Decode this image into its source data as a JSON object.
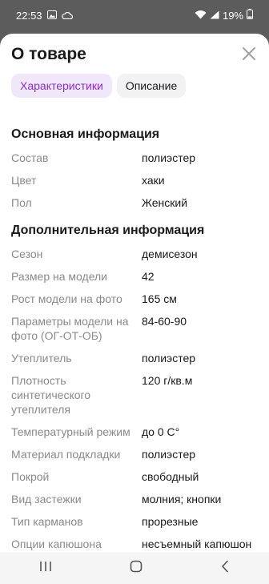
{
  "status_bar": {
    "time": "22:53",
    "battery": "19%"
  },
  "sheet": {
    "title": "О товаре",
    "tabs": [
      {
        "label": "Характеристики",
        "active": true
      },
      {
        "label": "Описание",
        "active": false
      }
    ]
  },
  "sections": [
    {
      "title": "Основная информация",
      "rows": [
        {
          "key": "Состав",
          "value": "полиэстер"
        },
        {
          "key": "Цвет",
          "value": "хаки"
        },
        {
          "key": "Пол",
          "value": "Женский"
        }
      ]
    },
    {
      "title": "Дополнительная информация",
      "rows": [
        {
          "key": "Сезон",
          "value": "демисезон"
        },
        {
          "key": "Размер на модели",
          "value": "42"
        },
        {
          "key": "Рост модели на фото",
          "value": "165 см"
        },
        {
          "key": "Параметры модели на фото (ОГ-ОТ-ОБ)",
          "value": "84-60-90"
        },
        {
          "key": "Утеплитель",
          "value": "полиэстер"
        },
        {
          "key": "Плотность синтетического утеплителя",
          "value": "120 г/кв.м"
        },
        {
          "key": "Температурный режим",
          "value": "до 0 С°"
        },
        {
          "key": "Материал подкладки",
          "value": "полиэстер"
        },
        {
          "key": "Покрой",
          "value": "свободный"
        },
        {
          "key": "Вид застежки",
          "value": "молния; кнопки"
        },
        {
          "key": "Тип карманов",
          "value": "прорезные"
        },
        {
          "key": "Опции капюшона",
          "value": "несъемный капюшон"
        }
      ]
    }
  ],
  "colors": {
    "accent": "#8a2fcf",
    "active_tab_bg": "#f0e7fb",
    "key_text": "#8a8a8f"
  }
}
